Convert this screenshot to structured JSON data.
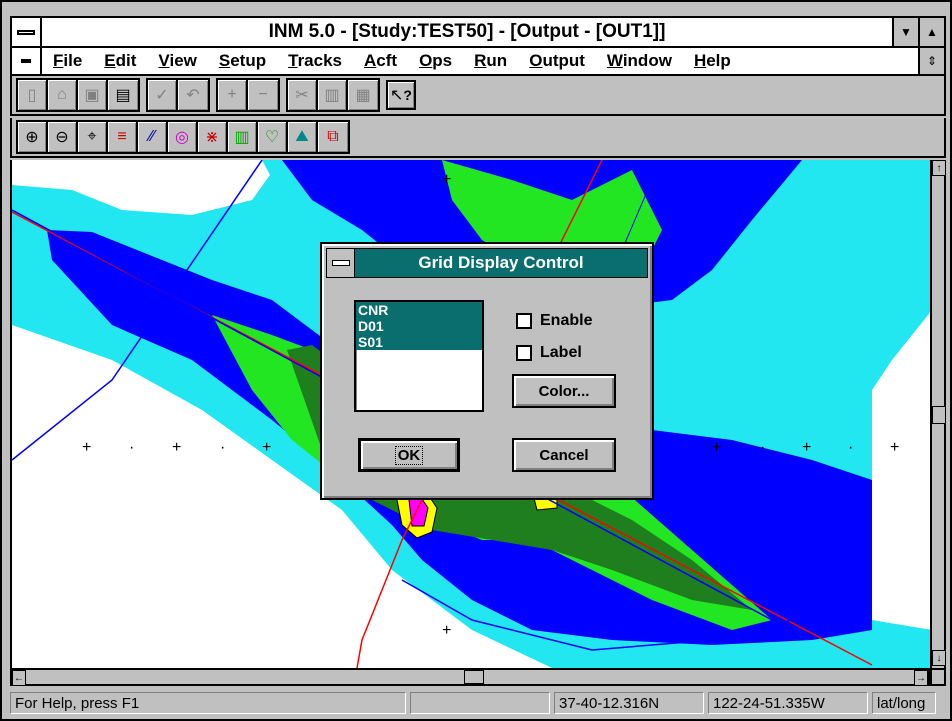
{
  "window": {
    "title": "INM 5.0 - [Study:TEST50] - [Output - [OUT1]]"
  },
  "menu": [
    "File",
    "Edit",
    "View",
    "Setup",
    "Tracks",
    "Acft",
    "Ops",
    "Run",
    "Output",
    "Window",
    "Help"
  ],
  "toolbar1": {
    "icons": [
      "new-icon",
      "open-icon",
      "save-icon",
      "print-icon",
      "check-icon",
      "undo-icon",
      "add-icon",
      "remove-icon",
      "cut-icon",
      "copy-icon",
      "paste-icon",
      "context-help-icon"
    ],
    "context_help_label": "?"
  },
  "toolbar2": {
    "icons": [
      "zoom-in-icon",
      "zoom-out-icon",
      "center-icon",
      "runways-icon",
      "tracks-icon",
      "contours-icon",
      "grid-icon",
      "locations-icon",
      "points-icon",
      "terrain-icon",
      "overlay-icon"
    ]
  },
  "dialog": {
    "title": "Grid Display Control",
    "list_items": [
      "CNR",
      "D01",
      "S01"
    ],
    "enable_label": "Enable",
    "label_label": "Label",
    "color_button": "Color...",
    "ok_button": "OK",
    "cancel_button": "Cancel"
  },
  "status": {
    "help": "For Help, press F1",
    "latitude": "37-40-12.316N",
    "longitude": "122-24-51.335W",
    "coord_mode": "lat/long"
  },
  "colors": {
    "dialog_title_bg": "#0a6e6e",
    "contour_cyan": "#22e6f0",
    "contour_blue": "#0000ff",
    "contour_green": "#22e622",
    "contour_darkgreen": "#1f7f1f",
    "contour_yellow": "#ffff00",
    "contour_magenta": "#ff00ff",
    "track_red": "#ff0000"
  }
}
